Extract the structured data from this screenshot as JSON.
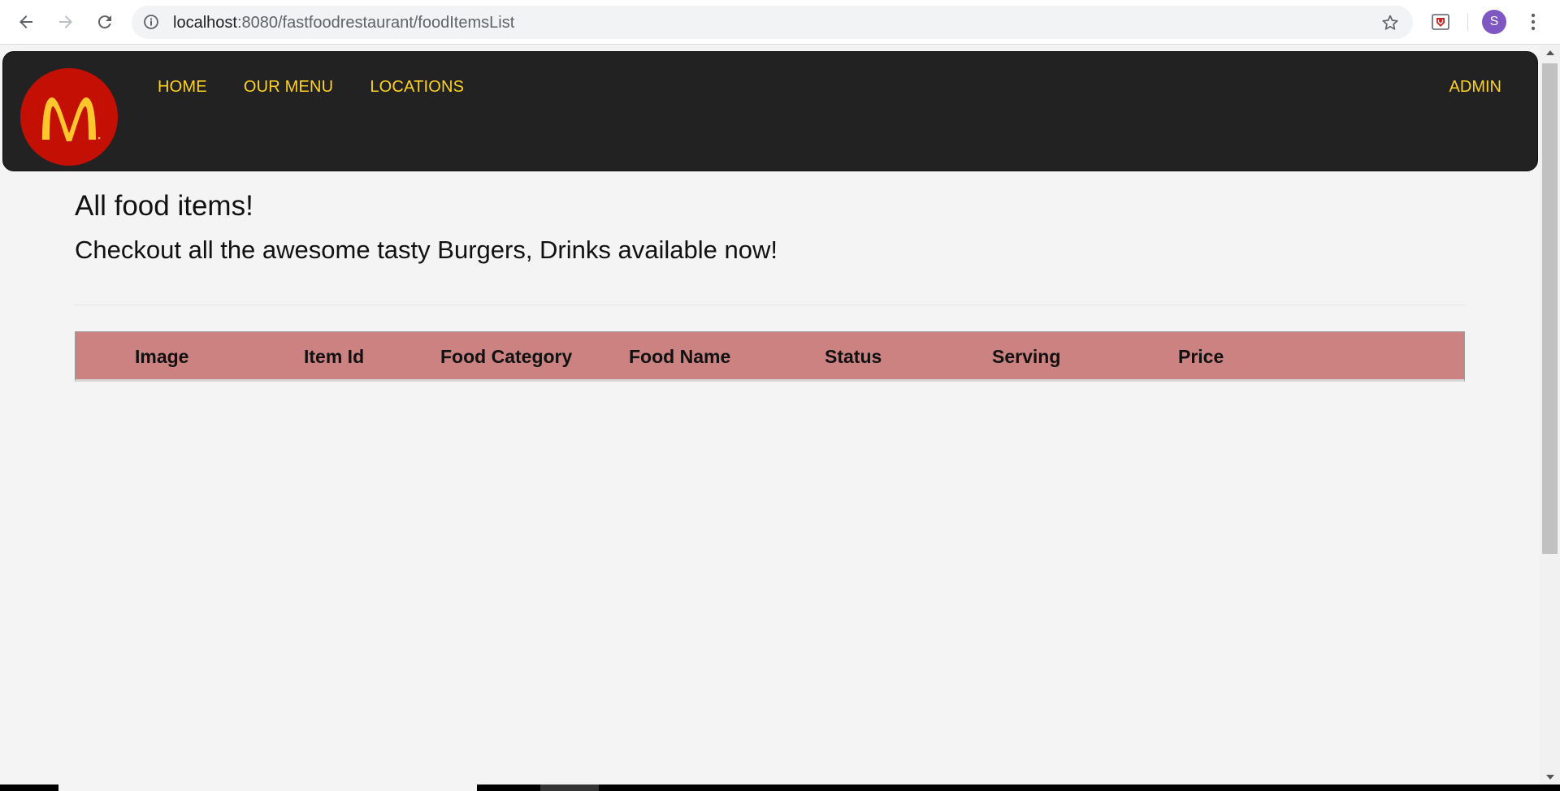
{
  "browser": {
    "url_host": "localhost",
    "url_rest": ":8080/fastfoodrestaurant/foodItemsList",
    "profile_initial": "S"
  },
  "navbar": {
    "links": [
      {
        "label": "HOME"
      },
      {
        "label": "OUR MENU"
      },
      {
        "label": "LOCATIONS"
      }
    ],
    "admin_label": "ADMIN",
    "link_color": "#ffd21f",
    "bg_color": "#222222",
    "logo_bg": "#c40f05"
  },
  "page": {
    "title": "All food items!",
    "subtitle": "Checkout all the awesome tasty Burgers, Drinks available now!"
  },
  "table": {
    "header_bg": "#cd8282",
    "columns": [
      "Image",
      "Item Id",
      "Food Category",
      "Food Name",
      "Status",
      "Serving",
      "Price"
    ],
    "rows": []
  }
}
